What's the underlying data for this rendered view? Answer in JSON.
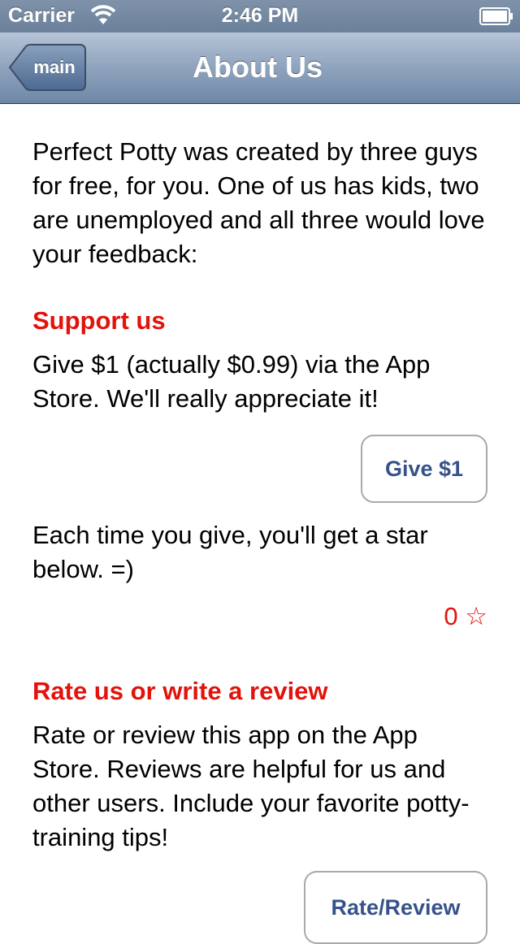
{
  "status_bar": {
    "carrier": "Carrier",
    "time": "2:46 PM"
  },
  "nav": {
    "back_label": "main",
    "title": "About Us"
  },
  "intro": "Perfect Potty was created by three guys for free, for you. One of us has kids, two are unemployed and all three would love your feedback:",
  "support": {
    "heading": "Support us",
    "text": "Give $1 (actually $0.99) via the App Store. We'll really appreciate it!",
    "button_label": "Give $1",
    "star_text": "Each time you give, you'll get a star below. =)",
    "star_count": "0 ☆"
  },
  "review": {
    "heading": "Rate us or write a review",
    "text": "Rate or review this app on the App Store. Reviews are helpful for us and other users. Include your favorite potty-training tips!",
    "button_label": "Rate/Review"
  },
  "colors": {
    "heading_red": "#e3120b",
    "button_text_blue": "#36528a",
    "nav_bar_blue": "#6f87a6"
  }
}
